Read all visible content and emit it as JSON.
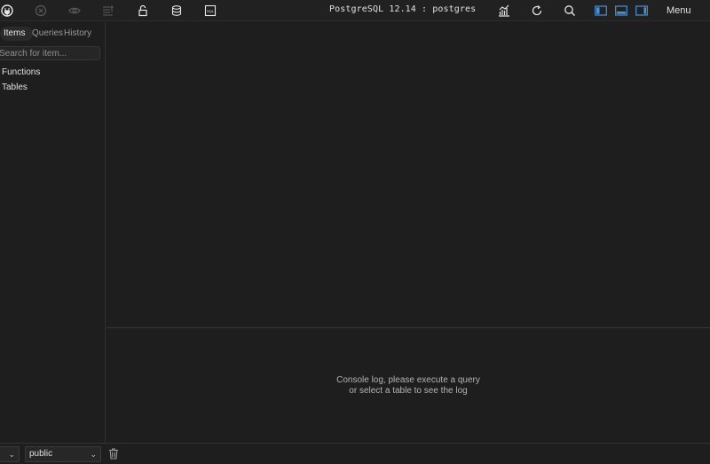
{
  "topbar": {
    "title": "PostgreSQL 12.14 : postgres",
    "menu_label": "Menu",
    "left_icons": [
      "connect-icon",
      "disconnect-icon",
      "view-icon",
      "sort-icon",
      "lock-icon",
      "database-icon",
      "sql-icon"
    ],
    "right_icons": [
      "chart-icon",
      "refresh-icon",
      "search-icon",
      "layout-left-icon",
      "layout-bottom-icon",
      "layout-right-icon"
    ],
    "accent_color": "#4a90d9"
  },
  "sidebar": {
    "tabs": [
      {
        "label": "Items",
        "active": true
      },
      {
        "label": "Queries",
        "active": false
      },
      {
        "label": "History",
        "active": false
      }
    ],
    "search": {
      "placeholder": "Search for item...",
      "value": ""
    },
    "tree": [
      {
        "label": "Functions"
      },
      {
        "label": "Tables"
      }
    ]
  },
  "bottom": {
    "schema_select": "public",
    "trash_icon": "trash-icon"
  },
  "console": {
    "line1": "Console log, please execute a query",
    "line2": "or select a table to see the log"
  }
}
